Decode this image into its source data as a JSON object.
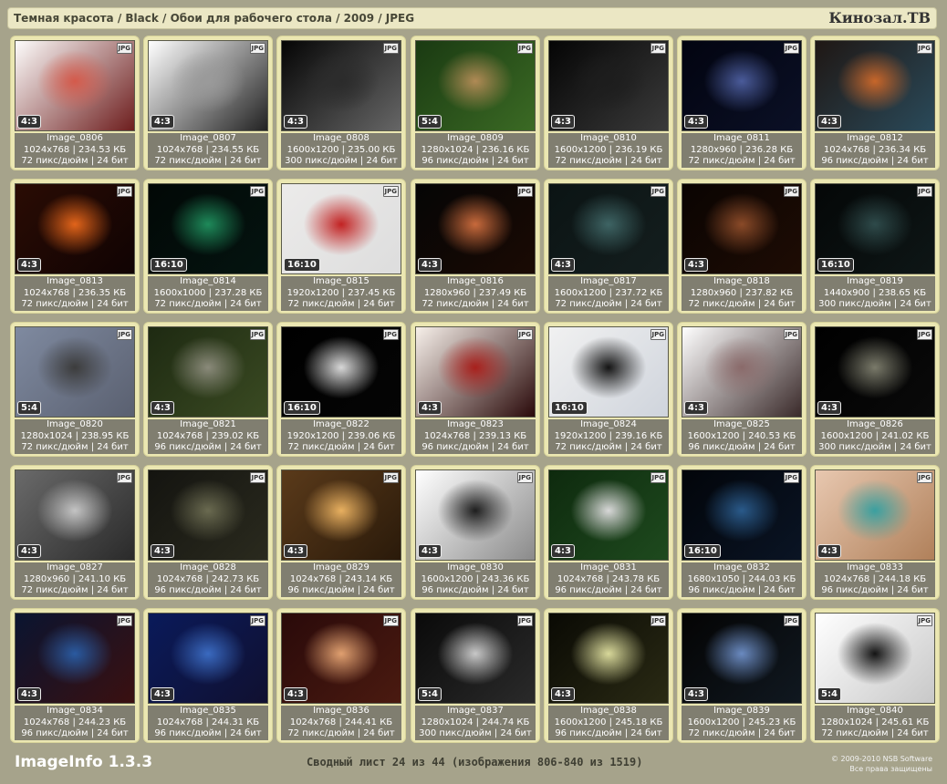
{
  "header": {
    "breadcrumb": "Темная красота / Black / Обои для рабочего стола / 2009 / JPEG",
    "site": "Кинозал.ТВ"
  },
  "badge": "JPG",
  "images": [
    {
      "name": "Image_0806",
      "dims": "1024x768",
      "size": "234.53 КБ",
      "dpi": "72 пикс/дюйм",
      "bits": "24 бит",
      "ratio": "4:3",
      "bg": [
        "#fdfcfb",
        "#d45a4b",
        "#6d1d1d"
      ]
    },
    {
      "name": "Image_0807",
      "dims": "1024x768",
      "size": "234.55 КБ",
      "dpi": "72 пикс/дюйм",
      "bits": "24 бит",
      "ratio": "4:3",
      "bg": [
        "#ffffff",
        "#9a9a9a",
        "#222222"
      ]
    },
    {
      "name": "Image_0808",
      "dims": "1600x1200",
      "size": "235.00 КБ",
      "dpi": "300 пикс/дюйм",
      "bits": "24 бит",
      "ratio": "4:3",
      "bg": [
        "#050505",
        "#2b2b2b",
        "#666666"
      ]
    },
    {
      "name": "Image_0809",
      "dims": "1280x1024",
      "size": "236.16 КБ",
      "dpi": "96 пикс/дюйм",
      "bits": "24 бит",
      "ratio": "5:4",
      "bg": [
        "#1a3a12",
        "#b08a55",
        "#3b6a24"
      ]
    },
    {
      "name": "Image_0810",
      "dims": "1600x1200",
      "size": "236.19 КБ",
      "dpi": "72 пикс/дюйм",
      "bits": "24 бит",
      "ratio": "4:3",
      "bg": [
        "#050505",
        "#1d1d1d",
        "#3a3a3a"
      ]
    },
    {
      "name": "Image_0811",
      "dims": "1280x960",
      "size": "236.28 КБ",
      "dpi": "72 пикс/дюйм",
      "bits": "24 бит",
      "ratio": "4:3",
      "bg": [
        "#020410",
        "#4a5b9a",
        "#0b1026"
      ]
    },
    {
      "name": "Image_0812",
      "dims": "1024x768",
      "size": "236.34 КБ",
      "dpi": "96 пикс/дюйм",
      "bits": "24 бит",
      "ratio": "4:3",
      "bg": [
        "#1f1714",
        "#c7662a",
        "#2a4a5a"
      ]
    },
    {
      "name": "Image_0813",
      "dims": "1024x768",
      "size": "236.35 КБ",
      "dpi": "72 пикс/дюйм",
      "bits": "24 бит",
      "ratio": "4:3",
      "bg": [
        "#2a0c04",
        "#e2641a",
        "#100303"
      ]
    },
    {
      "name": "Image_0814",
      "dims": "1600x1000",
      "size": "237.28 КБ",
      "dpi": "72 пикс/дюйм",
      "bits": "24 бит",
      "ratio": "16:10",
      "bg": [
        "#020806",
        "#1e8a5a",
        "#041410"
      ]
    },
    {
      "name": "Image_0815",
      "dims": "1920x1200",
      "size": "237.45 КБ",
      "dpi": "72 пикс/дюйм",
      "bits": "24 бит",
      "ratio": "16:10",
      "bg": [
        "#ecebea",
        "#c22222",
        "#dddddd"
      ]
    },
    {
      "name": "Image_0816",
      "dims": "1280x960",
      "size": "237.49 КБ",
      "dpi": "72 пикс/дюйм",
      "bits": "24 бит",
      "ratio": "4:3",
      "bg": [
        "#050505",
        "#c86a3c",
        "#1a0a04"
      ]
    },
    {
      "name": "Image_0817",
      "dims": "1600x1200",
      "size": "237.72 КБ",
      "dpi": "72 пикс/дюйм",
      "bits": "24 бит",
      "ratio": "4:3",
      "bg": [
        "#0b1414",
        "#3e6464",
        "#141e1e"
      ]
    },
    {
      "name": "Image_0818",
      "dims": "1280x960",
      "size": "237.82 КБ",
      "dpi": "72 пикс/дюйм",
      "bits": "24 бит",
      "ratio": "4:3",
      "bg": [
        "#0a0402",
        "#8a4a28",
        "#1e0c04"
      ]
    },
    {
      "name": "Image_0819",
      "dims": "1440x900",
      "size": "238.65 КБ",
      "dpi": "300 пикс/дюйм",
      "bits": "24 бит",
      "ratio": "16:10",
      "bg": [
        "#040707",
        "#2e4a4a",
        "#0e1616"
      ]
    },
    {
      "name": "Image_0820",
      "dims": "1280x1024",
      "size": "238.95 КБ",
      "dpi": "72 пикс/дюйм",
      "bits": "24 бит",
      "ratio": "5:4",
      "bg": [
        "#7f8aa0",
        "#3c3c3c",
        "#5a6070"
      ]
    },
    {
      "name": "Image_0821",
      "dims": "1024x768",
      "size": "239.02 КБ",
      "dpi": "96 пикс/дюйм",
      "bits": "24 бит",
      "ratio": "4:3",
      "bg": [
        "#1e2a12",
        "#8a8a7a",
        "#3a4a22"
      ]
    },
    {
      "name": "Image_0822",
      "dims": "1920x1200",
      "size": "239.06 КБ",
      "dpi": "72 пикс/дюйм",
      "bits": "24 бит",
      "ratio": "16:10",
      "bg": [
        "#000000",
        "#d8d8d8",
        "#050505"
      ]
    },
    {
      "name": "Image_0823",
      "dims": "1024x768",
      "size": "239.13 КБ",
      "dpi": "96 пикс/дюйм",
      "bits": "24 бит",
      "ratio": "4:3",
      "bg": [
        "#f7f0ea",
        "#a8201c",
        "#2a0a0a"
      ]
    },
    {
      "name": "Image_0824",
      "dims": "1920x1200",
      "size": "239.16 КБ",
      "dpi": "72 пикс/дюйм",
      "bits": "24 бит",
      "ratio": "16:10",
      "bg": [
        "#f1f1f1",
        "#141414",
        "#cfd4dc"
      ]
    },
    {
      "name": "Image_0825",
      "dims": "1600x1200",
      "size": "240.53 КБ",
      "dpi": "96 пикс/дюйм",
      "bits": "24 бит",
      "ratio": "4:3",
      "bg": [
        "#ffffff",
        "#8a6a6a",
        "#3a2a2a"
      ]
    },
    {
      "name": "Image_0826",
      "dims": "1600x1200",
      "size": "241.02 КБ",
      "dpi": "300 пикс/дюйм",
      "bits": "24 бит",
      "ratio": "4:3",
      "bg": [
        "#000000",
        "#7a7a6a",
        "#0a0a0a"
      ]
    },
    {
      "name": "Image_0827",
      "dims": "1280x960",
      "size": "241.10 КБ",
      "dpi": "72 пикс/дюйм",
      "bits": "24 бит",
      "ratio": "4:3",
      "bg": [
        "#6a6a6a",
        "#c4c4c4",
        "#2a2a2a"
      ]
    },
    {
      "name": "Image_0828",
      "dims": "1024x768",
      "size": "242.73 КБ",
      "dpi": "96 пикс/дюйм",
      "bits": "24 бит",
      "ratio": "4:3",
      "bg": [
        "#141410",
        "#6a6a50",
        "#2a2a1e"
      ]
    },
    {
      "name": "Image_0829",
      "dims": "1024x768",
      "size": "243.14 КБ",
      "dpi": "96 пикс/дюйм",
      "bits": "24 бит",
      "ratio": "4:3",
      "bg": [
        "#5a3a1a",
        "#e8b060",
        "#2a1a0a"
      ]
    },
    {
      "name": "Image_0830",
      "dims": "1600x1200",
      "size": "243.36 КБ",
      "dpi": "96 пикс/дюйм",
      "bits": "24 бит",
      "ratio": "4:3",
      "bg": [
        "#ffffff",
        "#1e1e1e",
        "#8a8a8a"
      ]
    },
    {
      "name": "Image_0831",
      "dims": "1024x768",
      "size": "243.78 КБ",
      "dpi": "96 пикс/дюйм",
      "bits": "24 бит",
      "ratio": "4:3",
      "bg": [
        "#0e2a0e",
        "#d8d8d8",
        "#1e4a1e"
      ]
    },
    {
      "name": "Image_0832",
      "dims": "1680x1050",
      "size": "244.03 КБ",
      "dpi": "96 пикс/дюйм",
      "bits": "24 бит",
      "ratio": "16:10",
      "bg": [
        "#02050a",
        "#2a5a8a",
        "#0a1424"
      ]
    },
    {
      "name": "Image_0833",
      "dims": "1024x768",
      "size": "244.18 КБ",
      "dpi": "96 пикс/дюйм",
      "bits": "24 бит",
      "ratio": "4:3",
      "bg": [
        "#e8c8b0",
        "#3aa0a0",
        "#b0805a"
      ]
    },
    {
      "name": "Image_0834",
      "dims": "1024x768",
      "size": "244.23 КБ",
      "dpi": "96 пикс/дюйм",
      "bits": "24 бит",
      "ratio": "4:3",
      "bg": [
        "#0a1430",
        "#2a5aa0",
        "#3a1010"
      ]
    },
    {
      "name": "Image_0835",
      "dims": "1024x768",
      "size": "244.31 КБ",
      "dpi": "96 пикс/дюйм",
      "bits": "24 бит",
      "ratio": "4:3",
      "bg": [
        "#0a1a5a",
        "#3a6ac0",
        "#101030"
      ]
    },
    {
      "name": "Image_0836",
      "dims": "1024x768",
      "size": "244.41 КБ",
      "dpi": "72 пикс/дюйм",
      "bits": "24 бит",
      "ratio": "4:3",
      "bg": [
        "#2a0a0a",
        "#e0a070",
        "#4a1a10"
      ]
    },
    {
      "name": "Image_0837",
      "dims": "1280x1024",
      "size": "244.74 КБ",
      "dpi": "300 пикс/дюйм",
      "bits": "24 бит",
      "ratio": "5:4",
      "bg": [
        "#0a0a0a",
        "#c8c8c8",
        "#2a2a2a"
      ]
    },
    {
      "name": "Image_0838",
      "dims": "1600x1200",
      "size": "245.18 КБ",
      "dpi": "96 пикс/дюйм",
      "bits": "24 бит",
      "ratio": "4:3",
      "bg": [
        "#0a0a04",
        "#d8d89a",
        "#2a2a14"
      ]
    },
    {
      "name": "Image_0839",
      "dims": "1600x1200",
      "size": "245.23 КБ",
      "dpi": "72 пикс/дюйм",
      "bits": "24 бит",
      "ratio": "4:3",
      "bg": [
        "#040404",
        "#6a8ac0",
        "#101820"
      ]
    },
    {
      "name": "Image_0840",
      "dims": "1280x1024",
      "size": "245.61 КБ",
      "dpi": "72 пикс/дюйм",
      "bits": "24 бит",
      "ratio": "5:4",
      "bg": [
        "#ffffff",
        "#141414",
        "#c8c8c8"
      ]
    }
  ],
  "footer": {
    "app": "ImageInfo 1.3.3",
    "summary": "Сводный лист 24 из 44 (изображения 806-840 из 1519)",
    "copyright": "© 2009-2010 NSB Software",
    "rights": "Все права защищены"
  }
}
